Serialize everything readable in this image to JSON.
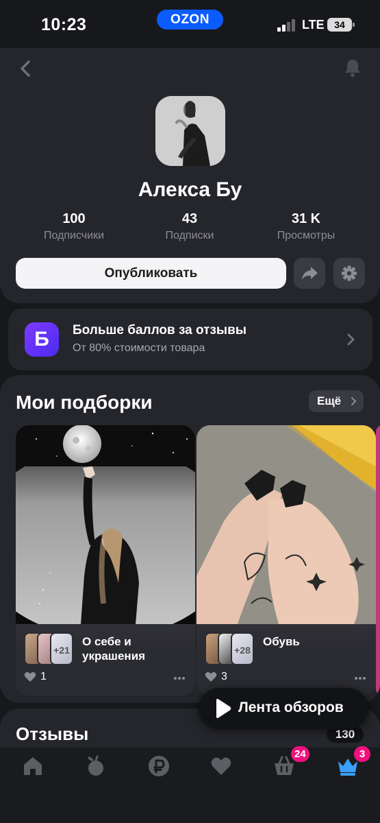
{
  "status_bar": {
    "time": "10:23",
    "brand": "OZON",
    "network": "LTE",
    "battery": "34"
  },
  "profile": {
    "name": "Алекса Бу",
    "stats": [
      {
        "value": "100",
        "label": "Подписчики"
      },
      {
        "value": "43",
        "label": "Подписки"
      },
      {
        "value": "31 K",
        "label": "Просмотры"
      }
    ],
    "publish_label": "Опубликовать"
  },
  "bonus": {
    "icon_letter": "Б",
    "title": "Больше баллов за отзывы",
    "subtitle": "От 80% стоимости товара"
  },
  "collections": {
    "title": "Мои подборки",
    "more_label": "Ещё",
    "items": [
      {
        "label": "О себе и украшения",
        "extra": "+21",
        "likes": "1"
      },
      {
        "label": "Обувь",
        "extra": "+28",
        "likes": "3"
      }
    ]
  },
  "feed_button": {
    "label": "Лента обзоров"
  },
  "reviews": {
    "title": "Отзывы",
    "count": "130"
  },
  "tabbar": {
    "items": [
      {
        "icon": "home-icon"
      },
      {
        "icon": "fresh-icon"
      },
      {
        "icon": "ruble-icon"
      },
      {
        "icon": "heart-icon"
      },
      {
        "icon": "basket-icon",
        "badge": "24"
      },
      {
        "icon": "crown-icon",
        "badge": "3"
      }
    ]
  },
  "colors": {
    "accent": "#0a5cff",
    "badge": "#f1117e",
    "bonus": "#6a35f5",
    "background": "#17181c",
    "card": "#25262b"
  }
}
